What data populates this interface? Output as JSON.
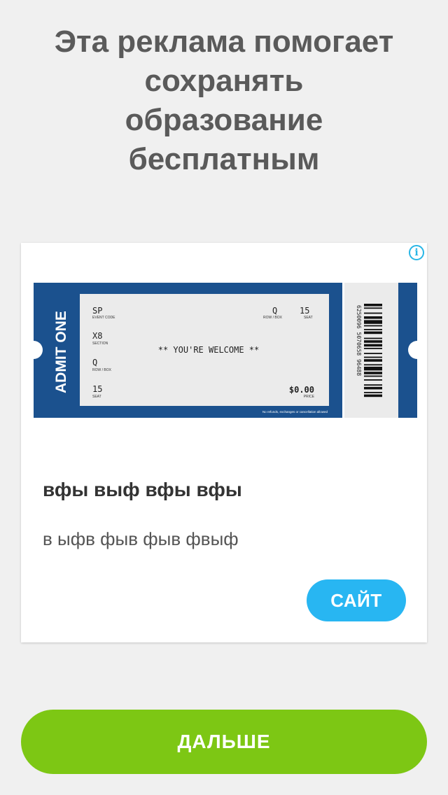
{
  "header": {
    "lines": [
      "Эта реклама помогает",
      "сохранять",
      "образование",
      "бесплатным"
    ]
  },
  "ad": {
    "title": "вфы выф вфы вфы",
    "description": "в ыфв фыв фыв фвыф",
    "cta_label": "САЙТ",
    "info_glyph": "i",
    "ticket": {
      "admit": "ADMIT ONE",
      "event_code": "SP",
      "event_code_label": "EVENT CODE",
      "section": "X8",
      "section_label": "SECTION",
      "row_box": "Q",
      "row_box_label": "ROW / BOX",
      "seat": "15",
      "seat_label": "SEAT",
      "top_row_box": "Q",
      "top_row_box_label": "ROW / BOX",
      "top_seat": "15",
      "top_seat_label": "SEAT",
      "message": "** YOU'RE WELCOME **",
      "price": "$0.00",
      "price_label": "PRICE",
      "fine_print": "No refunds, exchanges or cancellation allowed",
      "barcode_number": "6250096 5070658 96488"
    }
  },
  "footer": {
    "next_label": "ДАЛЬШЕ"
  },
  "colors": {
    "background": "#f0f0f0",
    "ticket_blue": "#1b518e",
    "info_blue": "#28b6e6",
    "site_button": "#28b6f2",
    "next_button": "#7dc714",
    "headline": "#5a5a5a"
  }
}
